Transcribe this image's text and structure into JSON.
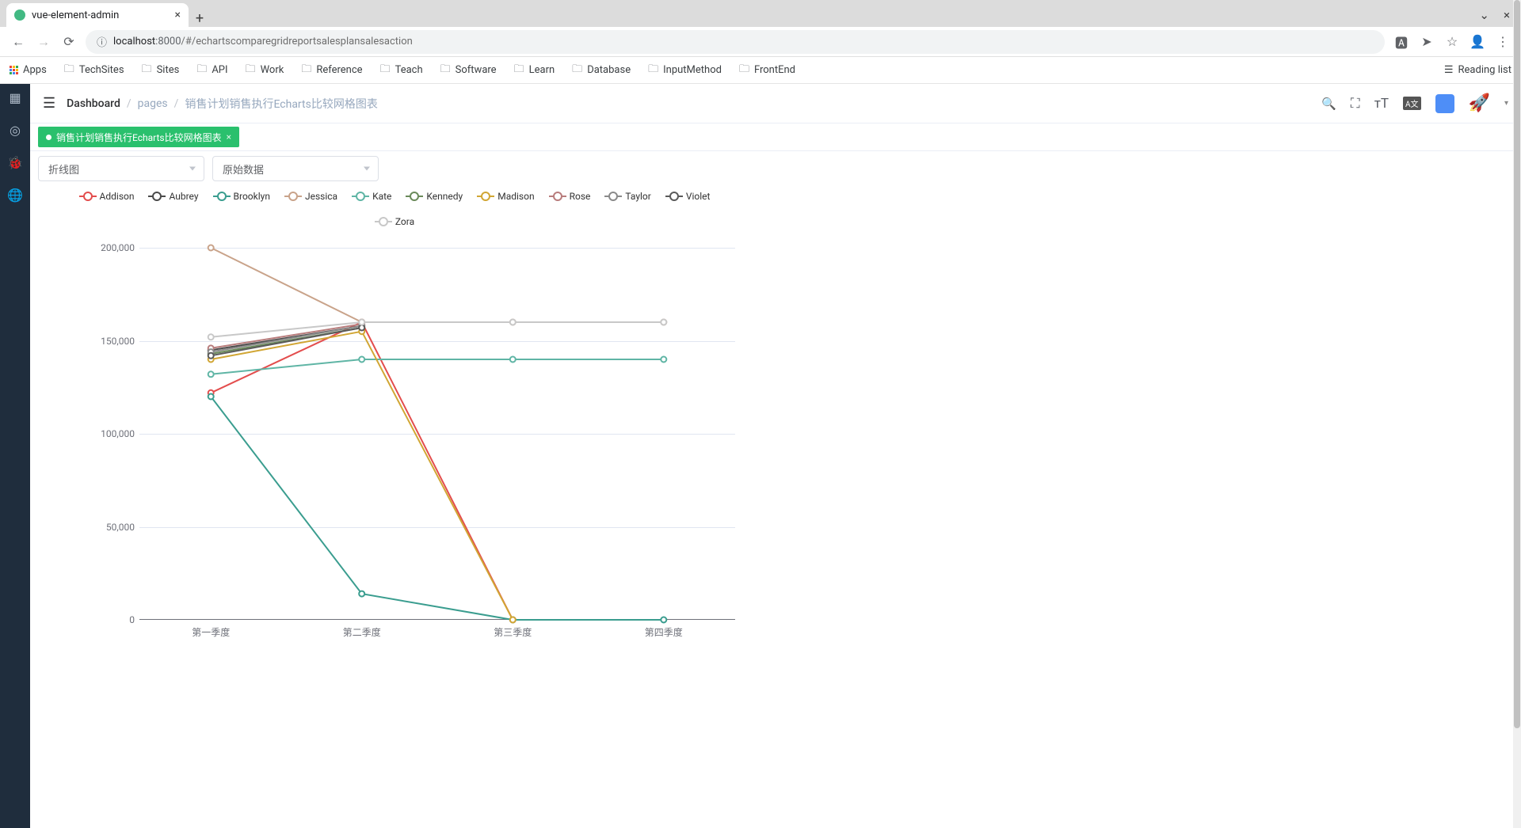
{
  "browser": {
    "tab_title": "vue-element-admin",
    "url_host": "localhost",
    "url_port": ":8000",
    "url_path": "/#/echartscomparegridreportsalesplansalesaction",
    "bookmarks": [
      "Apps",
      "TechSites",
      "Sites",
      "API",
      "Work",
      "Reference",
      "Teach",
      "Software",
      "Learn",
      "Database",
      "InputMethod",
      "FrontEnd"
    ],
    "reading_list": "Reading list"
  },
  "breadcrumb": {
    "dashboard": "Dashboard",
    "pages": "pages",
    "current": "销售计划销售执行Echarts比较网格图表"
  },
  "tagsview": {
    "active": "销售计划销售执行Echarts比较网格图表"
  },
  "controls": {
    "chart_type": "折线图",
    "data_mode": "原始数据"
  },
  "chart_data": {
    "type": "line",
    "categories": [
      "第一季度",
      "第二季度",
      "第三季度",
      "第四季度"
    ],
    "ylim": [
      0,
      200000
    ],
    "yticks": [
      0,
      50000,
      100000,
      150000,
      200000
    ],
    "ytick_labels": [
      "0",
      "50,000",
      "100,000",
      "150,000",
      "200,000"
    ],
    "series": [
      {
        "name": "Addison",
        "color": "#e34d4d",
        "values": [
          122000,
          160000,
          0,
          null
        ]
      },
      {
        "name": "Aubrey",
        "color": "#4a4a4a",
        "values": [
          145000,
          158000,
          null,
          null
        ]
      },
      {
        "name": "Brooklyn",
        "color": "#3a9d8f",
        "values": [
          120000,
          14000,
          0,
          0
        ]
      },
      {
        "name": "Jessica",
        "color": "#c9a38a",
        "values": [
          200000,
          160000,
          160000,
          160000
        ]
      },
      {
        "name": "Kate",
        "color": "#5fb5a5",
        "values": [
          132000,
          140000,
          140000,
          140000
        ]
      },
      {
        "name": "Kennedy",
        "color": "#6a8a5a",
        "values": [
          143000,
          157000,
          null,
          null
        ]
      },
      {
        "name": "Madison",
        "color": "#d1a634",
        "values": [
          140000,
          155000,
          0,
          null
        ]
      },
      {
        "name": "Rose",
        "color": "#b87c7c",
        "values": [
          146000,
          159000,
          null,
          null
        ]
      },
      {
        "name": "Taylor",
        "color": "#8a8a8a",
        "values": [
          144000,
          158000,
          null,
          null
        ]
      },
      {
        "name": "Violet",
        "color": "#5a5a5a",
        "values": [
          142000,
          157000,
          null,
          null
        ]
      },
      {
        "name": "Zora",
        "color": "#c8c8c8",
        "values": [
          152000,
          160000,
          160000,
          160000
        ]
      }
    ]
  }
}
